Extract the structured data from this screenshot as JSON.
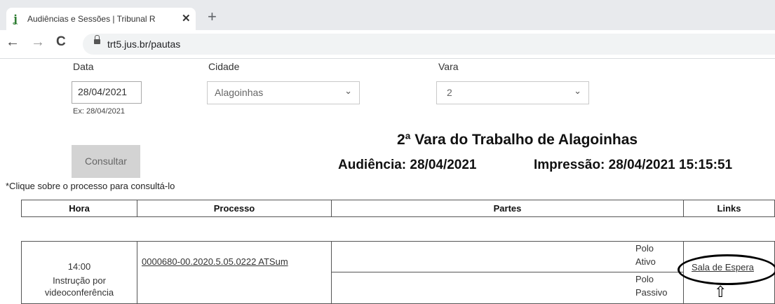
{
  "browser": {
    "tab_title": "Audiências e Sessões | Tribunal R",
    "tab_close": "✕",
    "new_tab": "+",
    "back": "←",
    "forward": "→",
    "reload": "C",
    "url": "trt5.jus.br/pautas"
  },
  "form": {
    "data_label": "Data",
    "data_value": "28/04/2021",
    "data_hint": "Ex: 28/04/2021",
    "cidade_label": "Cidade",
    "cidade_value": "Alagoinhas",
    "vara_label": "Vara",
    "vara_value": "2",
    "consultar_label": "Consultar"
  },
  "header": {
    "title": "2ª Vara do Trabalho de Alagoinhas",
    "audiencia": "Audiência: 28/04/2021",
    "impressao": "Impressão: 28/04/2021 15:15:51"
  },
  "note": "*Clique sobre o processo para consultá-lo",
  "table": {
    "headers": [
      "Hora",
      "Processo",
      "Partes",
      "Links"
    ],
    "row": {
      "hora": "14:00",
      "tipo_1": "Instrução por",
      "tipo_2": "videoconferência",
      "processo": "0000680-00.2020.5.05.0222 ATSum",
      "polo_ativo_1": "Polo",
      "polo_ativo_2": "Ativo",
      "polo_passivo_1": "Polo",
      "polo_passivo_2": "Passivo",
      "link": "Sala de Espera"
    }
  }
}
